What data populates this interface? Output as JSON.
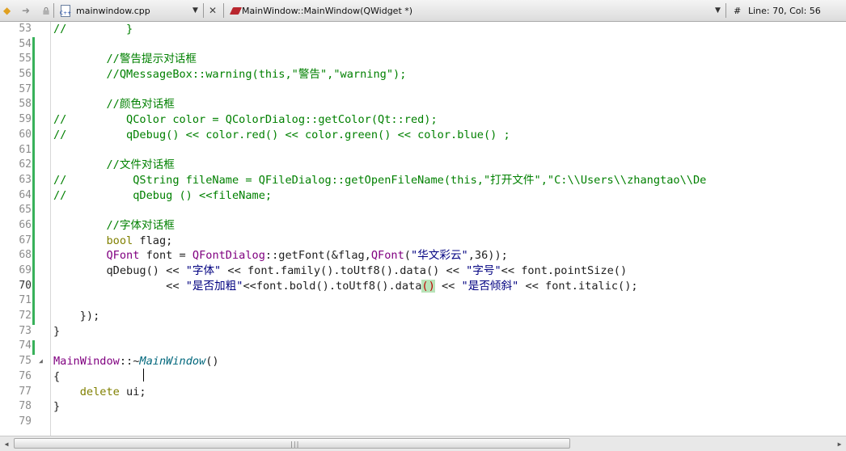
{
  "toolbar": {
    "back_icon": "back-arrow-icon",
    "forward_icon": "forward-arrow-icon",
    "file_name": "mainwindow.cpp",
    "file_icon_text": "C++",
    "close_glyph": "✕",
    "symbol": "MainWindow::MainWindow(QWidget *)",
    "hash": "#",
    "status": "Line: 70, Col: 56"
  },
  "editor": {
    "lines": [
      {
        "n": "53",
        "parts": [
          [
            "cm",
            "//         }"
          ]
        ]
      },
      {
        "n": "54",
        "parts": []
      },
      {
        "n": "55",
        "parts": [
          [
            "cm",
            "        //警告提示对话框"
          ]
        ]
      },
      {
        "n": "56",
        "parts": [
          [
            "cm",
            "        //QMessageBox::warning(this,\"警告\",\"warning\");"
          ]
        ]
      },
      {
        "n": "57",
        "parts": []
      },
      {
        "n": "58",
        "parts": [
          [
            "cm",
            "        //颜色对话框"
          ]
        ]
      },
      {
        "n": "59",
        "parts": [
          [
            "cm",
            "//         QColor color = QColorDialog::getColor(Qt::red);"
          ]
        ]
      },
      {
        "n": "60",
        "parts": [
          [
            "cm",
            "//         qDebug() << color.red() << color.green() << color.blue() ;"
          ]
        ]
      },
      {
        "n": "61",
        "parts": []
      },
      {
        "n": "62",
        "parts": [
          [
            "cm",
            "        //文件对话框"
          ]
        ]
      },
      {
        "n": "63",
        "parts": [
          [
            "cm",
            "//          QString fileName = QFileDialog::getOpenFileName(this,\"打开文件\",\"C:\\\\Users\\\\zhangtao\\\\De"
          ]
        ]
      },
      {
        "n": "64",
        "parts": [
          [
            "cm",
            "//          qDebug () <<fileName;"
          ]
        ]
      },
      {
        "n": "65",
        "parts": []
      },
      {
        "n": "66",
        "parts": [
          [
            "cm",
            "        //字体对话框"
          ]
        ]
      },
      {
        "n": "67",
        "parts": [
          [
            "",
            "        "
          ],
          [
            "kw",
            "bool"
          ],
          [
            "",
            " flag;"
          ]
        ]
      },
      {
        "n": "68",
        "parts": [
          [
            "",
            "        "
          ],
          [
            "ty",
            "QFont"
          ],
          [
            "",
            " font = "
          ],
          [
            "ty",
            "QFontDialog"
          ],
          [
            "",
            "::getFont(&flag,"
          ],
          [
            "ty",
            "QFont"
          ],
          [
            "",
            "("
          ],
          [
            "st",
            "\"华文彩云\""
          ],
          [
            "",
            ",36));"
          ]
        ]
      },
      {
        "n": "69",
        "parts": [
          [
            "",
            "        qDebug() << "
          ],
          [
            "st",
            "\"字体\""
          ],
          [
            "",
            " << font.family().toUtf8().data() << "
          ],
          [
            "st",
            "\"字号\""
          ],
          [
            "",
            "<< font.pointSize()"
          ]
        ]
      },
      {
        "n": "70",
        "parts": [
          [
            "",
            "                 << "
          ],
          [
            "st",
            "\"是否加粗\""
          ],
          [
            "",
            "<<font.bold().toUtf8().data"
          ],
          [
            "hl",
            "()"
          ],
          [
            "",
            " << "
          ],
          [
            "st",
            "\"是否倾斜\""
          ],
          [
            "",
            " << font.italic();"
          ]
        ]
      },
      {
        "n": "71",
        "parts": []
      },
      {
        "n": "72",
        "parts": [
          [
            "",
            "    });"
          ]
        ]
      },
      {
        "n": "73",
        "parts": [
          [
            "",
            "}"
          ]
        ]
      },
      {
        "n": "74",
        "parts": []
      },
      {
        "n": "75",
        "parts": [
          [
            "ty",
            "MainWindow"
          ],
          [
            "",
            "::~"
          ],
          [
            "fn-it",
            "MainWindow"
          ],
          [
            "",
            "()"
          ]
        ]
      },
      {
        "n": "76",
        "parts": [
          [
            "",
            "{"
          ]
        ]
      },
      {
        "n": "77",
        "parts": [
          [
            "",
            "    "
          ],
          [
            "kw",
            "delete"
          ],
          [
            "",
            " ui;"
          ]
        ]
      },
      {
        "n": "78",
        "parts": [
          [
            "",
            "}"
          ]
        ]
      },
      {
        "n": "79",
        "parts": []
      }
    ]
  },
  "colors": {
    "comment": "#008000",
    "keyword": "#808000",
    "type": "#800080",
    "string": "#000080",
    "change_bar": "#38b15a"
  }
}
